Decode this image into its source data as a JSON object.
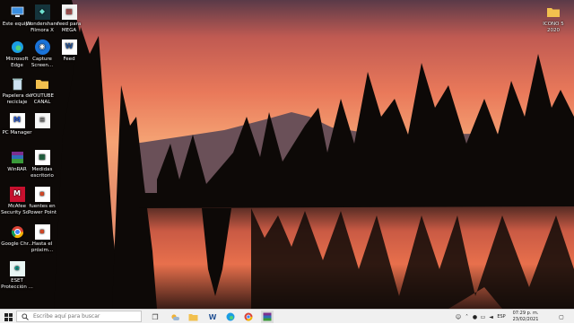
{
  "desktop": {
    "icons": [
      {
        "label": "Este equipo",
        "icon": "computer-icon"
      },
      {
        "label": "Wondershare Filmora X",
        "icon": "filmora-icon"
      },
      {
        "label": "feed para MEGA",
        "icon": "file-icon"
      },
      {
        "label": "Microsoft Edge",
        "icon": "edge-icon"
      },
      {
        "label": "Capture Screen...",
        "icon": "capture-icon"
      },
      {
        "label": "Feed",
        "icon": "word-icon"
      },
      {
        "label": "Papelera de reciclaje",
        "icon": "recycle-bin-icon"
      },
      {
        "label": "YOUTUBE CANAL",
        "icon": "folder-icon"
      },
      {
        "label": "PC Manager",
        "icon": "pc-manager-icon"
      },
      {
        "label": "",
        "icon": "document-icon"
      },
      {
        "label": "WinRAR",
        "icon": "winrar-icon"
      },
      {
        "label": "Medidas escritorio",
        "icon": "spreadsheet-icon"
      },
      {
        "label": "McAfee Security Sc...",
        "icon": "mcafee-icon"
      },
      {
        "label": "fuentes en Power Point",
        "icon": "powerpoint-file-icon"
      },
      {
        "label": "Google Chr...",
        "icon": "chrome-icon"
      },
      {
        "label": "Hasta el próxim...",
        "icon": "powerpoint-file-icon"
      },
      {
        "label": "ESET Protección ...",
        "icon": "eset-icon"
      },
      {
        "label": "ICONO 5 2020",
        "icon": "folder-icon"
      }
    ]
  },
  "taskbar": {
    "search_placeholder": "Escribe aquí para buscar",
    "apps": [
      "task-view-icon",
      "weather-icon",
      "file-explorer-icon",
      "word-icon",
      "edge-icon",
      "chrome-icon",
      "winrar-icon"
    ],
    "tray": {
      "language": "ESP"
    },
    "clock": {
      "time": "07:29 p. m.",
      "date": "23/02/2021"
    }
  },
  "colors": {
    "taskbar": "#f0f0f0",
    "sky_top": "#e86a4a",
    "sky_horizon": "#f6a070",
    "forest": "#0d0907",
    "lake": "#e8604a"
  }
}
